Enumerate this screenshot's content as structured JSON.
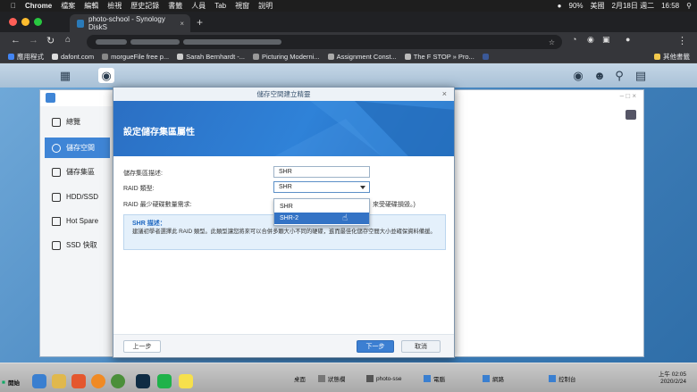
{
  "mac_menu": {
    "app": "Chrome",
    "items": [
      "檔案",
      "編輯",
      "檢視",
      "歷史記錄",
      "書籤",
      "人員",
      "Tab",
      "視窗",
      "說明"
    ],
    "battery": "90%",
    "input": "美國",
    "date": "2月18日 週二",
    "time": "16:58"
  },
  "chrome": {
    "tab_title": "photo-school - Synology DiskS",
    "close": "×",
    "new_tab": "+"
  },
  "bookmarks": [
    "應用程式",
    "dafont.com",
    "morgueFile free p...",
    "Sarah Bernhardt -...",
    "Picturing Moderni...",
    "Assignment Const...",
    "The F STOP » Pro..."
  ],
  "bookmarks_other": "其他書籤",
  "sidebar": {
    "items": [
      "總覽",
      "儲存空間",
      "儲存集區",
      "HDD/SSD",
      "Hot Spare",
      "SSD 快取"
    ]
  },
  "modal": {
    "title": "儲存空間建立精靈",
    "close": "×",
    "heading": "設定儲存集區屬性",
    "desc_label": "儲存集區描述:",
    "desc_value": "SHR",
    "raid_label": "RAID 類型:",
    "raid_value": "SHR",
    "min_disk_label": "RAID 最少硬碟數量需求:",
    "min_disk_suffix": "來受硬碟損毀。)",
    "options": [
      "SHR",
      "SHR-2"
    ],
    "info_title": "SHR 描述：",
    "info_body": "建議初學者選擇此 RAID 類型。此類型讓您將來可以合併多顆大小不同的硬碟，進而最佳化儲存空間大小並確保資料備援。",
    "prev_btn": "上一步",
    "next_btn": "下一步",
    "cancel_btn": "取消"
  },
  "taskbar": {
    "start": "開始",
    "desktop": "桌面",
    "win1": "狀態欄",
    "win2": "photo-sse",
    "win3": "電腦",
    "win4": "網路",
    "win5": "控制台",
    "clock_time": "上午 02:05",
    "clock_date": "2020/2/24"
  },
  "colors": {
    "accent": "#3f85d6",
    "banner": "#2f82d8"
  }
}
